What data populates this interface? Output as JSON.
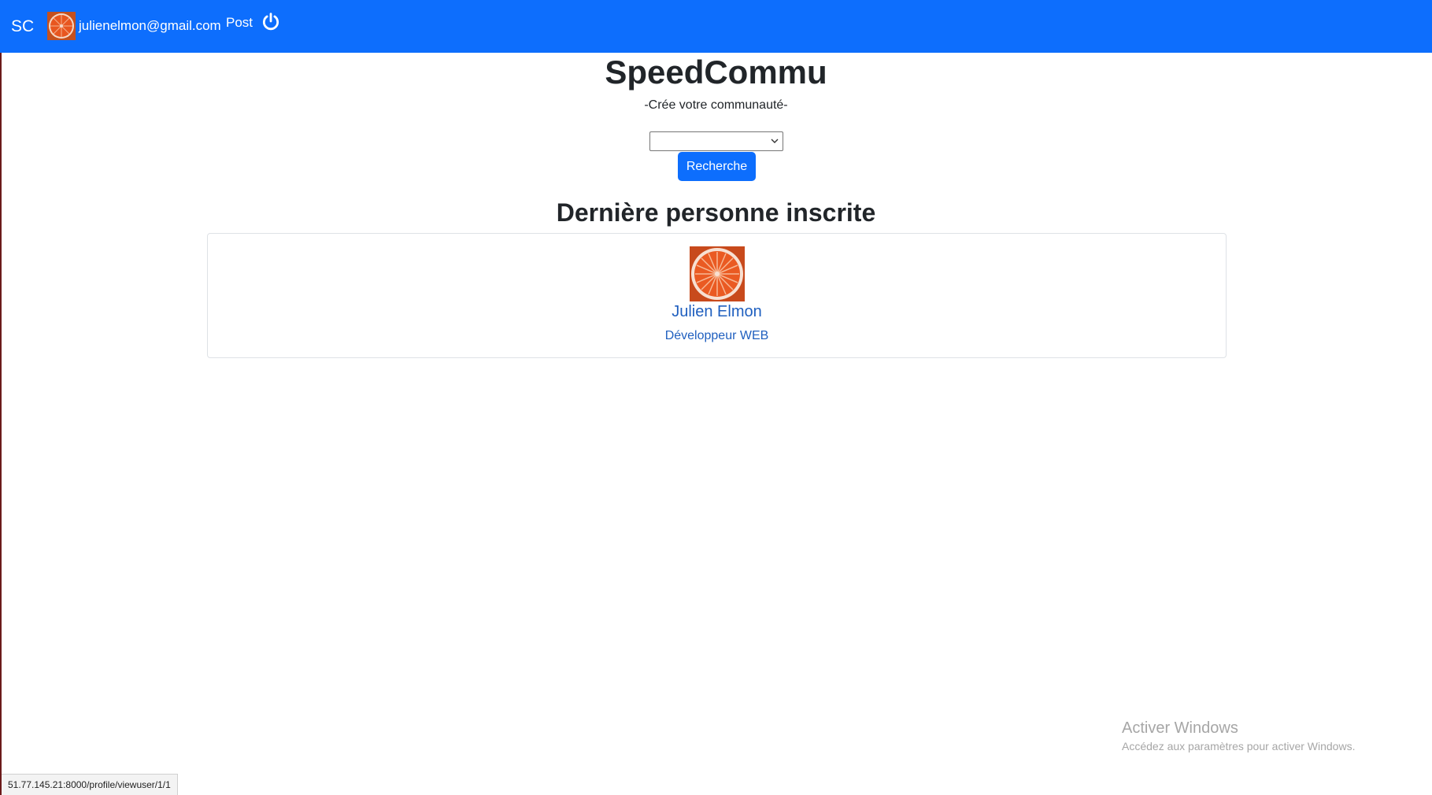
{
  "navbar": {
    "brand": "SC",
    "user_email": "julienelmon@gmail.com",
    "post_label": "Post",
    "power_icon": "power-icon",
    "accent_color": "#0d6efd"
  },
  "hero": {
    "title": "SpeedCommu",
    "tagline": "-Crée votre communauté-"
  },
  "search": {
    "select_value": "",
    "button_label": "Recherche"
  },
  "latest": {
    "heading": "Dernière personne inscrite",
    "user": {
      "name": "Julien Elmon",
      "role": "Développeur WEB"
    }
  },
  "watermark": {
    "title": "Activer Windows",
    "subtitle": "Accédez aux paramètres pour activer Windows."
  },
  "status_bar": {
    "url": "51.77.145.21:8000/profile/viewuser/1/1"
  }
}
